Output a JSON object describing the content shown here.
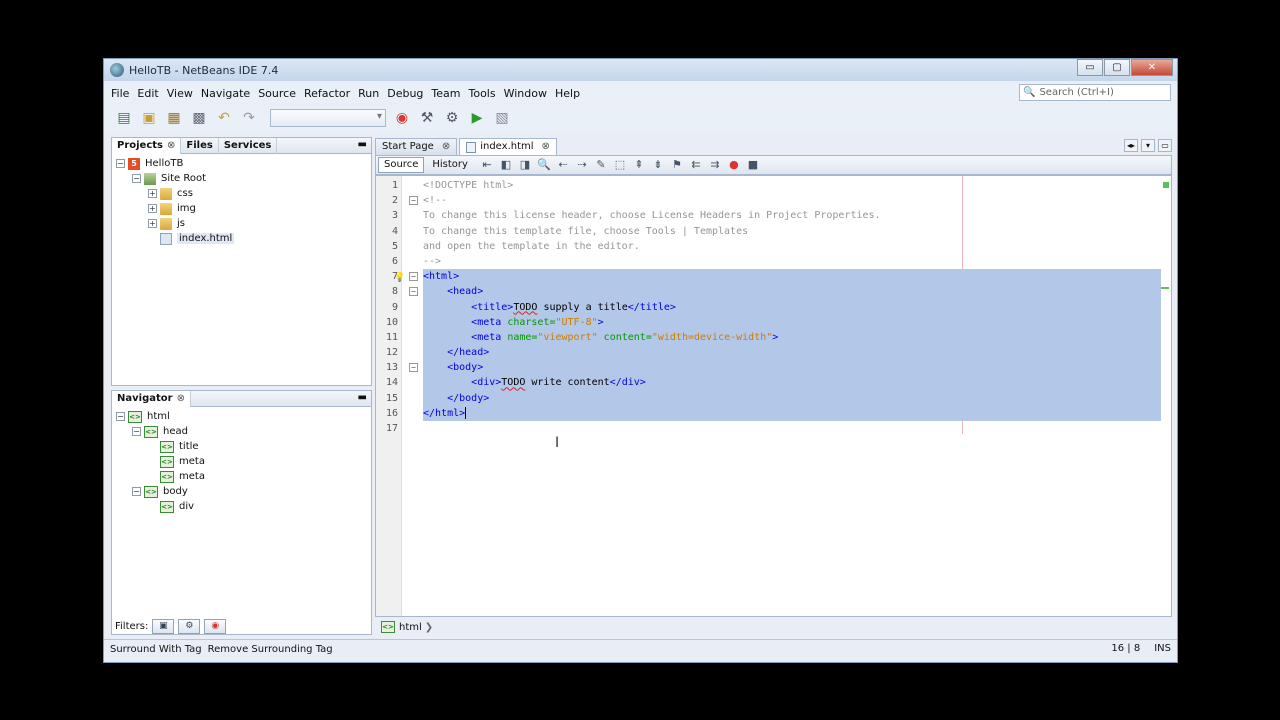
{
  "window": {
    "title": "HelloTB - NetBeans IDE 7.4",
    "controls": [
      "▭",
      "▢",
      "✕"
    ]
  },
  "menu": [
    "File",
    "Edit",
    "View",
    "Navigate",
    "Source",
    "Refactor",
    "Run",
    "Debug",
    "Team",
    "Tools",
    "Window",
    "Help"
  ],
  "search": {
    "placeholder": "Search (Ctrl+I)"
  },
  "projects_panel": {
    "tabs": [
      "Projects",
      "Files",
      "Services"
    ],
    "tree": [
      {
        "label": "HelloTB",
        "icon": "html5-project-icon",
        "depth": 0,
        "expanded": true
      },
      {
        "label": "Site Root",
        "icon": "site-root-icon",
        "depth": 1,
        "expanded": true
      },
      {
        "label": "css",
        "icon": "folder-icon",
        "depth": 2,
        "expanded": false
      },
      {
        "label": "img",
        "icon": "folder-icon",
        "depth": 2,
        "expanded": false
      },
      {
        "label": "js",
        "icon": "folder-icon",
        "depth": 2,
        "expanded": false
      },
      {
        "label": "index.html",
        "icon": "html-file-icon",
        "depth": 2,
        "selected": true
      }
    ]
  },
  "navigator_panel": {
    "title": "Navigator",
    "tree": [
      {
        "label": "html",
        "depth": 0,
        "expanded": true
      },
      {
        "label": "head",
        "depth": 1,
        "expanded": true
      },
      {
        "label": "title",
        "depth": 2
      },
      {
        "label": "meta",
        "depth": 2
      },
      {
        "label": "meta",
        "depth": 2
      },
      {
        "label": "body",
        "depth": 1,
        "expanded": true
      },
      {
        "label": "div",
        "depth": 2
      }
    ],
    "filters_label": "Filters:"
  },
  "editor": {
    "tabs": [
      {
        "label": "Start Page",
        "active": false
      },
      {
        "label": "index.html",
        "active": true
      }
    ],
    "views": [
      "Source",
      "History"
    ],
    "lines": [
      {
        "n": "1",
        "html": "<span class='c-com'>&lt;!DOCTYPE html&gt;</span>"
      },
      {
        "n": "2",
        "html": "<span class='c-com'>&lt;!--</span>",
        "fold": "-"
      },
      {
        "n": "3",
        "html": "<span class='c-com'>To change this license header, choose License Headers in Project Properties.</span>"
      },
      {
        "n": "4",
        "html": "<span class='c-com'>To change this template file, choose Tools | Templates</span>"
      },
      {
        "n": "5",
        "html": "<span class='c-com'>and open the template in the editor.</span>"
      },
      {
        "n": "6",
        "html": "<span class='c-com'>--&gt;</span>"
      },
      {
        "n": "7",
        "html": "<span class='c-tag'>&lt;html&gt;</span>",
        "fold": "-",
        "sel": true,
        "bulb": true
      },
      {
        "n": "8",
        "html": "    <span class='c-tag'>&lt;head&gt;</span>",
        "fold": "-",
        "sel": true
      },
      {
        "n": "9",
        "html": "        <span class='c-tag'>&lt;title&gt;</span><span class='c-txt squig'>TODO</span><span class='c-txt'> supply a title</span><span class='c-tag'>&lt;/title&gt;</span>",
        "sel": true
      },
      {
        "n": "10",
        "html": "        <span class='c-tag'>&lt;meta</span> <span class='c-attr'>charset=</span><span class='c-str'>\"UTF-8\"</span><span class='c-tag'>&gt;</span>",
        "sel": true
      },
      {
        "n": "11",
        "html": "        <span class='c-tag'>&lt;meta</span> <span class='c-attr'>name=</span><span class='c-str'>\"viewport\"</span> <span class='c-attr'>content=</span><span class='c-str'>\"width=device-width\"</span><span class='c-tag'>&gt;</span>",
        "sel": true
      },
      {
        "n": "12",
        "html": "    <span class='c-tag'>&lt;/head&gt;</span>",
        "sel": true
      },
      {
        "n": "13",
        "html": "    <span class='c-tag'>&lt;body&gt;</span>",
        "fold": "-",
        "sel": true
      },
      {
        "n": "14",
        "html": "        <span class='c-tag'>&lt;div&gt;</span><span class='c-txt squig'>TODO</span><span class='c-txt'> write content</span><span class='c-tag'>&lt;/div&gt;</span>",
        "sel": true
      },
      {
        "n": "15",
        "html": "    <span class='c-tag'>&lt;/body&gt;</span>",
        "sel": true
      },
      {
        "n": "16",
        "html": "<span class='c-tag'>&lt;/html&gt;</span><span class='caret'></span>",
        "sel": true
      },
      {
        "n": "17",
        "html": ""
      }
    ],
    "breadcrumb": "html"
  },
  "status": {
    "left": [
      "Surround With Tag",
      "Remove Surrounding Tag"
    ],
    "position": "16 | 8",
    "mode": "INS"
  }
}
